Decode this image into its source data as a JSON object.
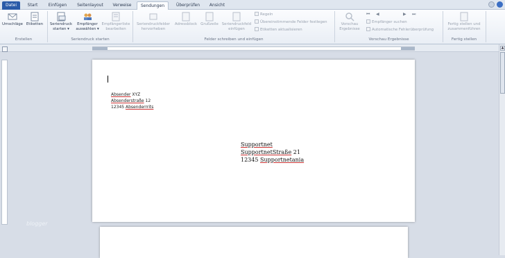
{
  "tabs": [
    {
      "label": "Datei"
    },
    {
      "label": "Start"
    },
    {
      "label": "Einfügen"
    },
    {
      "label": "Seitenlayout"
    },
    {
      "label": "Verweise"
    },
    {
      "label": "Sendungen"
    },
    {
      "label": "Überprüfen"
    },
    {
      "label": "Ansicht"
    }
  ],
  "groups": {
    "erstellen": "Erstellen",
    "seriendruck": "Seriendruck starten",
    "felder": "Felder schreiben und einfügen",
    "vorschau": "Vorschau Ergebnisse",
    "fertig": "Fertig stellen"
  },
  "buttons": {
    "umschlaege": "Umschläge",
    "etiketten": "Etiketten",
    "seriendruck_l1": "Seriendruck",
    "seriendruck_l2": "starten ▾",
    "empfaenger_l1": "Empfänger",
    "empfaenger_l2": "auswählen ▾",
    "empfliste_l1": "Empfängerliste",
    "empfliste_l2": "bearbeiten",
    "hervorheben_l1": "Seriendruckfelder",
    "hervorheben_l2": "hervorheben",
    "adressblock": "Adressblock",
    "grusszeile": "Grußzeile",
    "feld_l1": "Seriendruckfeld",
    "feld_l2": "einfügen",
    "regeln": "Regeln",
    "uebereinst": "Übereinstimmende Felder festlegen",
    "etikett_akt": "Etiketten aktualisieren",
    "vorschau_l1": "Vorschau",
    "vorschau_l2": "Ergebnisse",
    "empf_suchen": "Empfänger suchen",
    "auto_pruef": "Automatische Fehlerüberprüfung",
    "fertig_l1": "Fertig stellen und",
    "fertig_l2": "zusammenführen"
  },
  "icons": {
    "nav_first": "⏮",
    "nav_prev": "◀",
    "nav_next": "▶",
    "nav_last": "⏭"
  },
  "document": {
    "sender": {
      "line1_a": "Absender",
      "line1_b": " XYZ",
      "line2_a": "Absenderstraße",
      "line2_b": " 12",
      "line3_a": "12345 ",
      "line3_b": "Absenderrrits"
    },
    "recipient": {
      "line1": "Supportnet",
      "line2_a": "SupportnetStraße",
      "line2_b": " 21",
      "line3_a": "12345 ",
      "line3_b": "Supportnetania"
    }
  },
  "watermark": "blogger",
  "colors": {
    "file_tab": "#2a5ba8",
    "ribbon_bg": "#f3f6fa",
    "workspace": "#d7dde7"
  }
}
